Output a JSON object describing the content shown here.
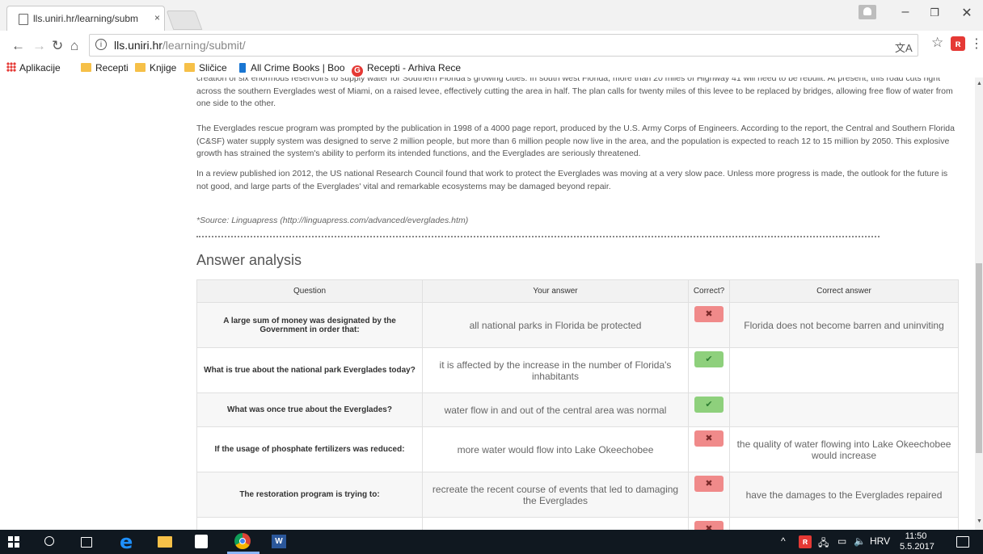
{
  "browser": {
    "tab_title": "lls.uniri.hr/learning/subm",
    "tab_close": "×",
    "url_host": "lls.uniri.hr",
    "url_path": "/learning/submit/",
    "window_minimize": "–",
    "window_maximize": "❐",
    "window_close": "✕"
  },
  "bookmarks": {
    "apps": "Aplikacije",
    "item1": "Recepti",
    "item2": "Knjige",
    "item3": "Sličice",
    "item4": "All Crime Books | Boo",
    "item5": "Recepti - Arhiva Rece"
  },
  "article": {
    "para_top": "creation of six enormous reservoirs to supply water for Southern Florida's growing cities. In south west Florida, more than 20 miles of Highway 41 will need to be rebuilt. At present, this road cuts right across the southern Everglades west of Miami, on a raised levee, effectively cutting the area in half. The plan calls for twenty miles of this levee to be replaced by bridges, allowing free flow of water from one side to the other.",
    "para2": "The Everglades rescue program was prompted by the publication in 1998 of a 4000 page report, produced by the U.S. Army Corps of Engineers. According to the report, the Central and Southern Florida (C&SF) water supply system was designed to serve 2 million people, but more than 6 million people now live in the area, and the population is expected to reach 12 to 15 million by 2050. This explosive growth has strained the system's ability to perform its intended functions, and the Everglades are seriously threatened.",
    "para3": "In a review published ion 2012, the US national Research Council found that work to protect the Everglades was moving at a very slow pace.  Unless more progress is made, the outlook for the future is not good, and large parts of the Everglades' vital and remarkable ecosystems may be damaged beyond repair.",
    "source": "*Source: Linguapress (http://linguapress.com/advanced/everglades.htm)"
  },
  "analysis": {
    "heading": "Answer analysis",
    "columns": [
      "Question",
      "Your answer",
      "Correct?",
      "Correct answer"
    ],
    "rows": [
      {
        "question": "A large sum of money was designated by the Government in order that:",
        "your_answer": "all national parks in Florida be protected",
        "correct": "✖",
        "correct_answer": "Florida does not become barren and uninviting"
      },
      {
        "question": "What is true about the national park Everglades today?",
        "your_answer": "it is affected by the increase in the number of Florida's inhabitants",
        "correct": "✔",
        "correct_answer": ""
      },
      {
        "question": "What was once true about the Everglades?",
        "your_answer": "water flow in and out of the central area was normal",
        "correct": "✔",
        "correct_answer": ""
      },
      {
        "question": "If the usage of phosphate fertilizers was reduced:",
        "your_answer": "more water would flow into Lake Okeechobee",
        "correct": "✖",
        "correct_answer": "the quality of water flowing into Lake Okeechobee would increase"
      },
      {
        "question": "The restoration program is trying to:",
        "your_answer": "recreate the recent course of events that led to damaging the Everglades",
        "correct": "✖",
        "correct_answer": "have the damages to the Everglades repaired"
      },
      {
        "question": "",
        "your_answer": "",
        "correct": "✖",
        "correct_answer": ""
      }
    ]
  },
  "taskbar": {
    "word_label": "W",
    "language": "HRV",
    "time": "11:50",
    "date": "5.5.2017",
    "tray_up": "^"
  },
  "icons": {
    "back": "back-arrow-icon",
    "forward": "forward-arrow-icon",
    "reload": "reload-icon",
    "home": "home-icon",
    "info": "info-icon",
    "star": "star-icon"
  },
  "colors": {
    "wrong_badge": "#f08a8a",
    "right_badge": "#8ed07c",
    "taskbar": "#101820"
  }
}
